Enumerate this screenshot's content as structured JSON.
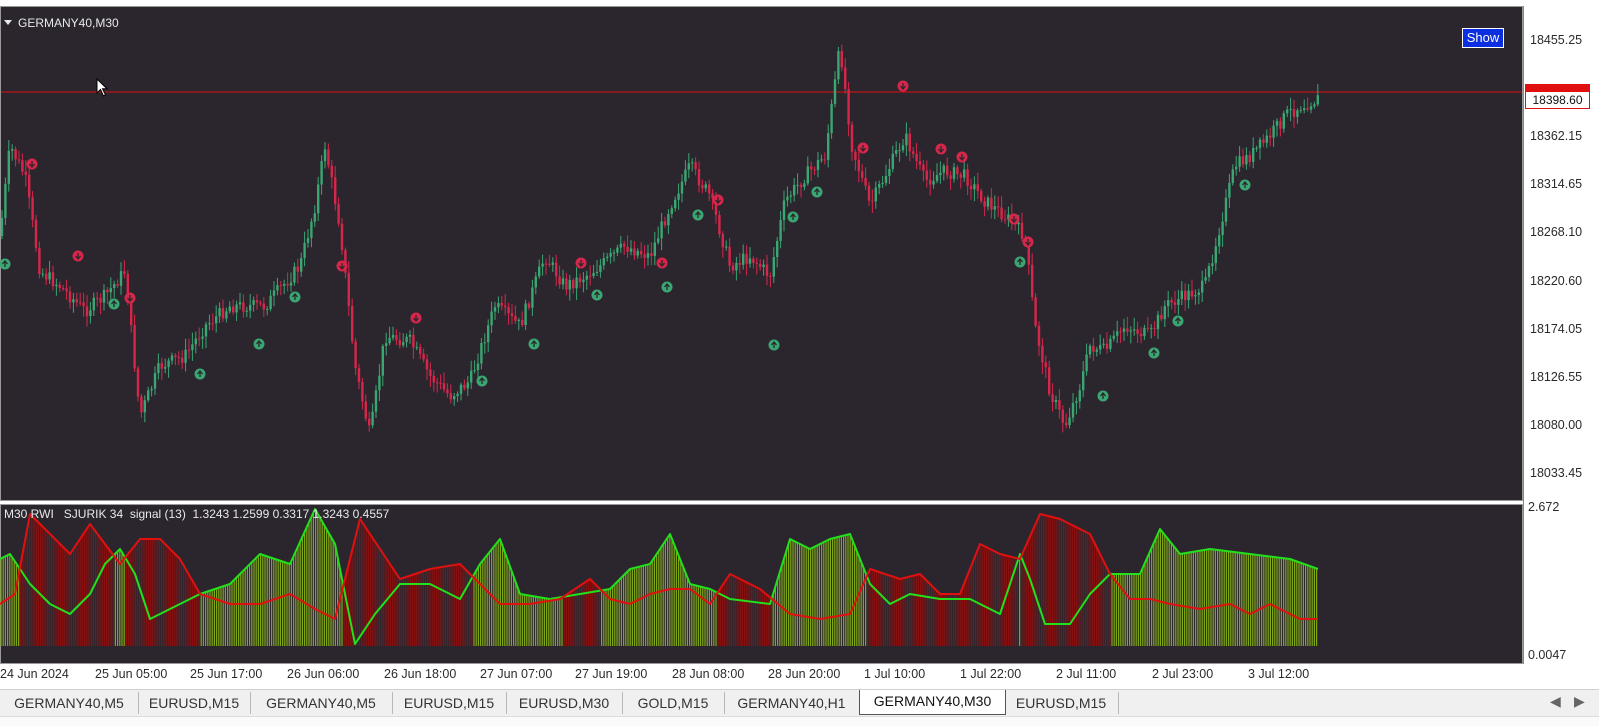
{
  "window": {
    "symbol_title": "GERMANY40,M30",
    "show_button": "Show",
    "current_price": "18398.60"
  },
  "price_axis": {
    "labels": [
      "18455.25",
      "18362.15",
      "18314.65",
      "18268.10",
      "18220.60",
      "18174.05",
      "18126.55",
      "18080.00",
      "18033.45"
    ]
  },
  "indicator": {
    "title": "M30 RWI   SJURIK 34  signal (13)  1.3243 1.2599 0.3317 1.3243 0.4557",
    "axis_top": "2.672",
    "axis_bottom": "0.0047",
    "axis_bottom_overlap": "0.00"
  },
  "time_axis": {
    "labels": [
      "24 Jun 2024",
      "25 Jun 05:00",
      "25 Jun 17:00",
      "26 Jun 06:00",
      "26 Jun 18:00",
      "27 Jun 07:00",
      "27 Jun 19:00",
      "28 Jun 08:00",
      "28 Jun 20:00",
      "1 Jul 10:00",
      "1 Jul 22:00",
      "2 Jul 11:00",
      "2 Jul 23:00",
      "3 Jul 12:00"
    ]
  },
  "tabs": [
    {
      "label": "GERMANY40,M5"
    },
    {
      "label": "EURUSD,M15"
    },
    {
      "label": "GERMANY40,M5"
    },
    {
      "label": "EURUSD,M15"
    },
    {
      "label": "EURUSD,M30"
    },
    {
      "label": "GOLD,M15"
    },
    {
      "label": "GERMANY40,H1"
    },
    {
      "label": "GERMANY40,M30",
      "active": true
    },
    {
      "label": "EURUSD,M15"
    }
  ],
  "colors": {
    "background": "#2b262e",
    "bull_candle": "#3aa672",
    "bear_candle": "#d6264a",
    "price_line": "#e01010",
    "ind_green_line": "#22e01a",
    "ind_red_line": "#e01010",
    "hist_green": "#7ea618",
    "hist_red": "#8a1010"
  },
  "icons": {
    "sell_arrow": "red-down-arrow-icon",
    "buy_arrow": "green-up-arrow-icon",
    "cursor": "mouse-pointer-icon",
    "scroll_left": "◀",
    "scroll_right": "▶"
  }
}
